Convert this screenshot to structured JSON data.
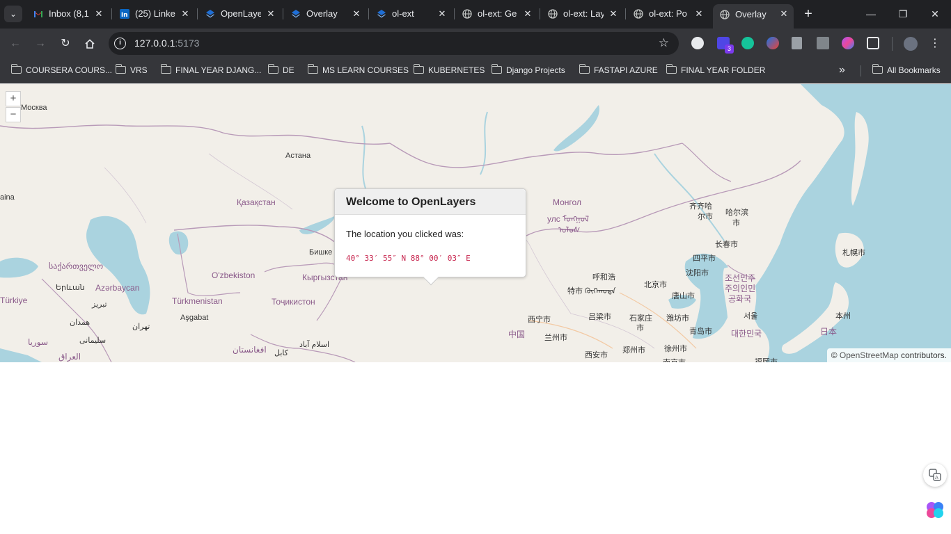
{
  "tabs": [
    {
      "title": "Inbox (8,1",
      "icon": "gmail-icon"
    },
    {
      "title": "(25) Linke",
      "icon": "linkedin-icon"
    },
    {
      "title": "OpenLaye",
      "icon": "openlayers-icon"
    },
    {
      "title": "Overlay",
      "icon": "openlayers-icon"
    },
    {
      "title": "ol-ext",
      "icon": "openlayers-icon"
    },
    {
      "title": "ol-ext: Ge",
      "icon": "globe-icon"
    },
    {
      "title": "ol-ext: Lay",
      "icon": "globe-icon"
    },
    {
      "title": "ol-ext: Po",
      "icon": "globe-icon"
    },
    {
      "title": "Overlay",
      "icon": "globe-icon",
      "active": true
    }
  ],
  "toolbar": {
    "url_host": "127.0.0.1",
    "url_port": ":5173",
    "extension_badge": "3"
  },
  "bookmarks": {
    "items": [
      "COURSERA COURS...",
      "VRS",
      "FINAL YEAR DJANG...",
      "DE",
      "MS LEARN COURSES",
      "KUBERNETES",
      "Django Projects",
      "FASTAPI AZURE",
      "FINAL YEAR FOLDER"
    ],
    "overflow": "»",
    "all": "All Bookmarks"
  },
  "map": {
    "zoom_in": "+",
    "zoom_out": "−",
    "attribution_prefix": "©",
    "attribution_link": "OpenStreetMap",
    "attribution_suffix": "contributors.",
    "labels": {
      "moskva": "Москва",
      "astana": "Астана",
      "kazakhstan": "Қазақстан",
      "mongol": "Монгол",
      "ulus": "улс ᠮᠣᠩᠭᠣᠯ",
      "ulus2": "ᠤᠯᠤᠰ",
      "bishkek": "Бишке",
      "kyrgyz": "Кыргызстан",
      "uzbekistan": "O'zbekiston",
      "turkmenistan": "Türkmenistan",
      "tajik": "Тоҷикистон",
      "ashgabat": "Aşgabat",
      "azerbaycan": "Azərbaycan",
      "sakartvelo": "საქართველო",
      "yerevan": "Երևան",
      "turkiye": "Türkiye",
      "tabriz": "تبریز",
      "tehran": "تهران",
      "hamadan": "همدان",
      "soleimani": "سلیمانی",
      "sourya": "سوريا",
      "iraq": "العراق",
      "afghanistan": "افغانستان",
      "kabul": "کابل",
      "islamabad": "اسلام آباد",
      "china": "中国",
      "xining": "西宁市",
      "lanzhou": "兰州市",
      "xian": "西安市",
      "zhengzhou": "郑州市",
      "lvliang": "吕梁市",
      "hohhot": "呼和浩",
      "tehot": "特市 ᠬᠥᠬᠡᠬᠣᠲᠠ",
      "beijing": "北京市",
      "shijiazhuang": "石家庄",
      "shi": "市",
      "tangshan": "唐山市",
      "shenyang": "沈阳市",
      "siping": "四平市",
      "changchun": "长春市",
      "qiqihar": "齐齐哈",
      "erShi": "尔市",
      "harbin": "哈尔滨",
      "harbinShi": "市",
      "weifang": "潍坊市",
      "qingdao": "青岛市",
      "xuzhou": "徐州市",
      "nanjing": "南京市",
      "dprk1": "조선민주",
      "dprk2": "주의인민",
      "dprk3": "공화국",
      "seoul": "서울",
      "korea": "대한민국",
      "sapporo": "札幌市",
      "honshu": "本州",
      "japan": "日本",
      "fukuoka": "福岡市",
      "aina": "aina"
    }
  },
  "popup": {
    "title": "Welcome to OpenLayers",
    "text": "The location you clicked was:",
    "coordinate": "40° 33′ 55″ N 88° 00′ 03″ E"
  },
  "colors": {
    "water": "#aad3df",
    "land": "#f2efe9",
    "border": "#b89ab8",
    "popup_code": "#c7254e"
  }
}
